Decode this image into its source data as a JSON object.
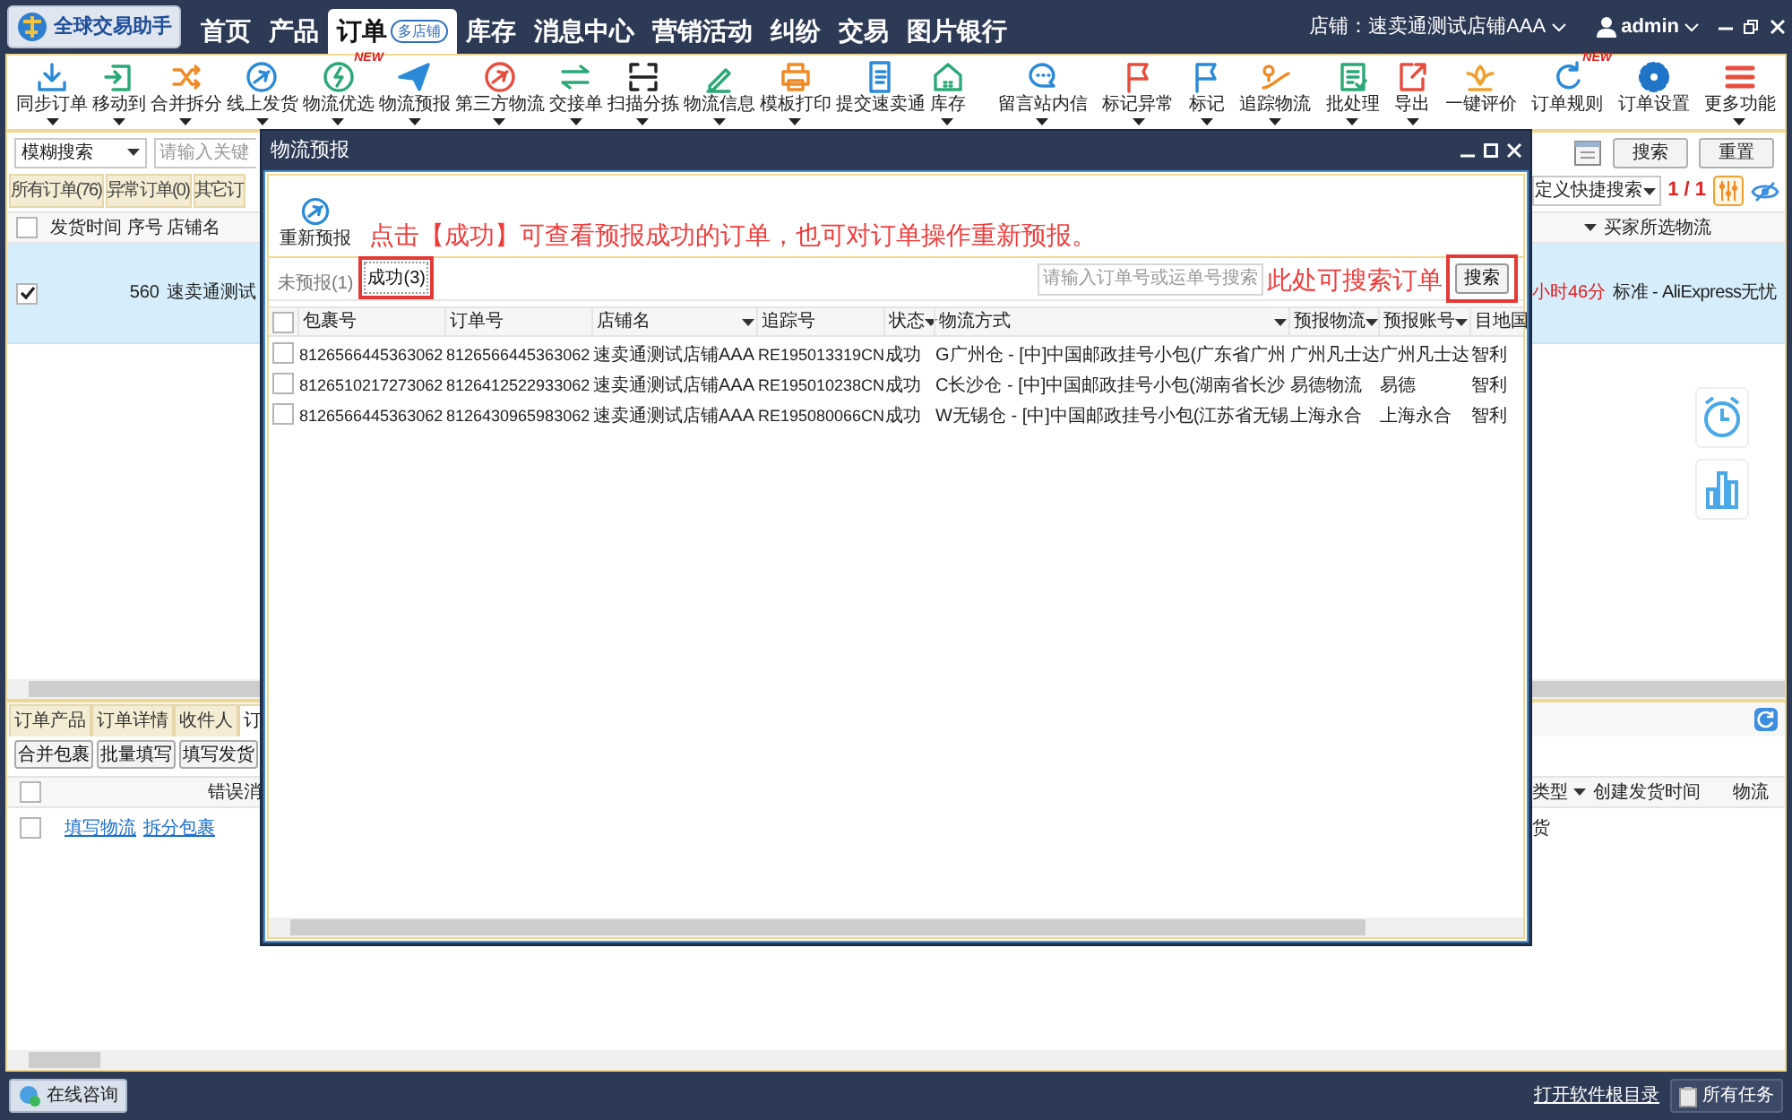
{
  "app": {
    "logo": "全球交易助手",
    "nav": [
      {
        "label": "首页",
        "selected": false
      },
      {
        "label": "产品",
        "selected": false
      },
      {
        "label": "订单",
        "selected": true,
        "badge": "多店铺"
      },
      {
        "label": "库存",
        "selected": false
      },
      {
        "label": "消息中心",
        "selected": false
      },
      {
        "label": "营销活动",
        "selected": false
      },
      {
        "label": "纠纷",
        "selected": false
      },
      {
        "label": "交易",
        "selected": false
      },
      {
        "label": "图片银行",
        "selected": false
      }
    ],
    "shop": "店铺：速卖通测试店铺AAA",
    "user": "admin"
  },
  "toolbar_left": [
    {
      "label": "同步订单",
      "dropdown": true
    },
    {
      "label": "移动到",
      "dropdown": true
    },
    {
      "label": "合并拆分",
      "dropdown": true
    },
    {
      "label": "线上发货",
      "dropdown": true
    },
    {
      "label": "物流优选",
      "dropdown": true,
      "badge": "NEW"
    },
    {
      "label": "物流预报",
      "dropdown": true
    },
    {
      "label": "第三方物流",
      "dropdown": true
    },
    {
      "label": "交接单",
      "dropdown": true
    },
    {
      "label": "扫描分拣",
      "dropdown": true
    },
    {
      "label": "物流信息",
      "dropdown": true
    },
    {
      "label": "模板打印",
      "dropdown": true
    },
    {
      "label": "提交速卖通",
      "dropdown": false
    },
    {
      "label": "库存",
      "dropdown": true
    }
  ],
  "toolbar_right": [
    {
      "label": "留言站内信",
      "dropdown": true
    },
    {
      "label": "标记异常",
      "dropdown": true
    },
    {
      "label": "标记",
      "dropdown": true
    },
    {
      "label": "追踪物流",
      "dropdown": true
    },
    {
      "label": "批处理",
      "dropdown": true
    },
    {
      "label": "导出",
      "dropdown": true
    },
    {
      "label": "一键评价",
      "dropdown": false
    },
    {
      "label": "订单规则",
      "dropdown": false,
      "badge": "NEW"
    },
    {
      "label": "订单设置",
      "dropdown": false
    },
    {
      "label": "更多功能",
      "dropdown": true
    }
  ],
  "search": {
    "mode": "模糊搜索",
    "placeholder": "请输入关键",
    "buttons": [
      "搜索",
      "重置"
    ]
  },
  "order_tabs": [
    {
      "label": "所有订单(76)",
      "selected": false
    },
    {
      "label": "异常订单(0)",
      "selected": false
    },
    {
      "label": "其它订",
      "selected": false
    }
  ],
  "quick_search": "定义快捷搜索",
  "page": "1 / 1",
  "orders_table": {
    "select_all": false,
    "columns": [
      "发货时间",
      "序号",
      "店铺名"
    ],
    "right_column": "买家所选物流",
    "rows": [
      {
        "selected": true,
        "checked": true,
        "number": "560",
        "shop": "速卖通测试",
        "time_left": "小时46分",
        "buyer_logistics": "标准 - AliExpress无忧"
      }
    ]
  },
  "detail_tabs": [
    {
      "label": "订单产品",
      "selected": false
    },
    {
      "label": "订单详情",
      "selected": false
    },
    {
      "label": "收件人",
      "selected": false
    },
    {
      "label": "订",
      "selected": true
    }
  ],
  "detail_buttons": [
    "合并包裹",
    "批量填写",
    "填写发货"
  ],
  "packages_table": {
    "select_all": false,
    "columns": [
      "错误消"
    ],
    "right_columns": [
      {
        "label": "类型",
        "filter": true
      },
      {
        "label": "创建发货时间",
        "filter": false
      },
      {
        "label": "物流",
        "filter": false
      }
    ],
    "rows": [
      {
        "checked": false,
        "links": [
          "填写物流",
          "拆分包裹"
        ],
        "type": "货"
      }
    ]
  },
  "status_bar": {
    "consult": "在线咨询",
    "open_folder": "打开软件根目录",
    "tasks": "所有任务"
  },
  "dialog": {
    "title": "物流预报",
    "action": "重新预报",
    "hint": "点击【成功】可查看预报成功的订单，也可对订单操作重新预报。",
    "tabs": [
      {
        "label": "未预报(1)",
        "selected": false,
        "highlighted": false
      },
      {
        "label": "成功(3)",
        "selected": true,
        "highlighted": true
      }
    ],
    "search": {
      "placeholder": "请输入订单号或运单号搜索",
      "hint": "此处可搜索订单",
      "button": "搜索",
      "highlighted": true
    },
    "select_all": false,
    "columns": [
      {
        "label": "包裹号",
        "filter": false
      },
      {
        "label": "订单号",
        "filter": false
      },
      {
        "label": "店铺名",
        "filter": true
      },
      {
        "label": "追踪号",
        "filter": false
      },
      {
        "label": "状态",
        "filter": true
      },
      {
        "label": "物流方式",
        "filter": true
      },
      {
        "label": "预报物流",
        "filter": true
      },
      {
        "label": "预报账号",
        "filter": true
      },
      {
        "label": "目地国",
        "filter": false
      }
    ],
    "rows": [
      {
        "checked": false,
        "cells": [
          "8126566445363062",
          "8126566445363062",
          "速卖通测试店铺AAA",
          "RE195013319CN",
          "成功",
          "G广州仓 - [中]中国邮政挂号小包(广东省广州",
          "广州凡士达",
          "广州凡士达",
          "智利"
        ]
      },
      {
        "checked": false,
        "cells": [
          "8126510217273062",
          "8126412522933062",
          "速卖通测试店铺AAA",
          "RE195010238CN",
          "成功",
          "C长沙仓 - [中]中国邮政挂号小包(湖南省长沙",
          "易德物流",
          "易德",
          "智利"
        ]
      },
      {
        "checked": false,
        "cells": [
          "8126566445363062",
          "8126430965983062",
          "速卖通测试店铺AAA",
          "RE195080066CN",
          "成功",
          "W无锡仓 - [中]中国邮政挂号小包(江苏省无锡",
          "上海永合",
          "上海永合",
          "智利"
        ]
      }
    ]
  }
}
